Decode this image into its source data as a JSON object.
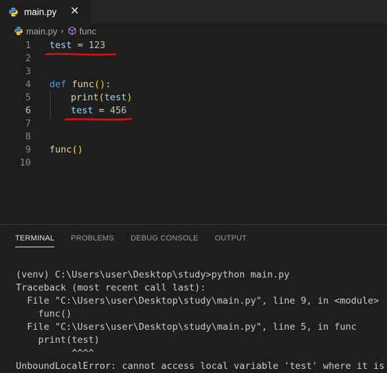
{
  "tab": {
    "filename": "main.py",
    "icon": "python-icon",
    "close_glyph": "✕"
  },
  "breadcrumb": {
    "file": "main.py",
    "separator": "›",
    "symbol": "func"
  },
  "editor": {
    "line_numbers": [
      "1",
      "2",
      "3",
      "4",
      "5",
      "6",
      "7",
      "8",
      "9",
      "10"
    ],
    "active_line": 6,
    "lines": {
      "l1": {
        "var": "test",
        "op": " = ",
        "num": "123"
      },
      "l4": {
        "kw": "def",
        "sp": " ",
        "fn": "func",
        "paren": "()",
        "colon": ":"
      },
      "l5": {
        "fn": "print",
        "open": "(",
        "arg": "test",
        "close": ")"
      },
      "l6": {
        "var": "test",
        "op": " = ",
        "num": "456"
      },
      "l9": {
        "fn": "func",
        "paren": "()"
      }
    },
    "underline_color": "#e01010"
  },
  "panel": {
    "tabs": [
      "TERMINAL",
      "PROBLEMS",
      "DEBUG CONSOLE",
      "OUTPUT"
    ],
    "active_tab": "TERMINAL",
    "terminal_lines": [
      "(venv) C:\\Users\\user\\Desktop\\study>python main.py",
      "Traceback (most recent call last):",
      "  File \"C:\\Users\\user\\Desktop\\study\\main.py\", line 9, in <module>",
      "    func()",
      "  File \"C:\\Users\\user\\Desktop\\study\\main.py\", line 5, in func",
      "    print(test)",
      "          ^^^^",
      "UnboundLocalError: cannot access local variable 'test' where it is"
    ]
  },
  "colors": {
    "background": "#1e1e1e",
    "keyword": "#569cd6",
    "function": "#dcdcaa",
    "variable": "#9cdcfe",
    "number": "#b5cea8"
  }
}
